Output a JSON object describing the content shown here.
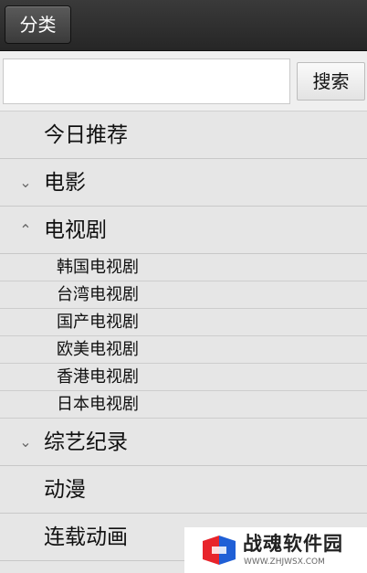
{
  "topbar": {
    "category_button": "分类"
  },
  "search": {
    "value": "",
    "placeholder": "",
    "button_label": "搜索"
  },
  "menu": {
    "today": {
      "label": "今日推荐"
    },
    "movie": {
      "label": "电影",
      "chevron": "chevron-down-icon"
    },
    "tv": {
      "label": "电视剧",
      "chevron": "chevron-up-icon",
      "children": [
        "韩国电视剧",
        "台湾电视剧",
        "国产电视剧",
        "欧美电视剧",
        "香港电视剧",
        "日本电视剧"
      ]
    },
    "variety": {
      "label": "综艺纪录",
      "chevron": "chevron-down-icon"
    },
    "anime": {
      "label": "动漫"
    },
    "serial_anime": {
      "label": "连载动画"
    }
  },
  "watermark": {
    "title": "战魂软件园",
    "url": "WWW.ZHJWSX.COM"
  },
  "colors": {
    "topbar": "#2f2f2f",
    "background": "#e6e6e6",
    "logo_red": "#e8242b",
    "logo_blue": "#1f5fd6"
  }
}
